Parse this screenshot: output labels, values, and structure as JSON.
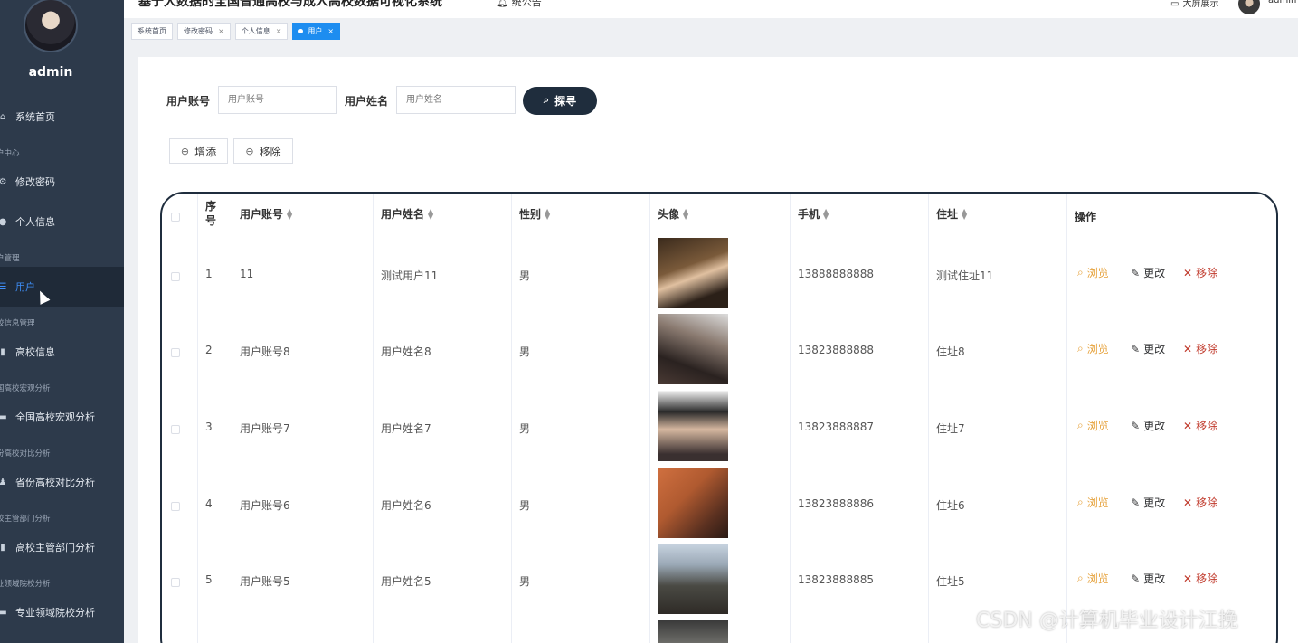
{
  "header": {
    "title": "基于大数据的全国普通高校与成人高校数据可视化系统",
    "notice": "统公告",
    "bigscreen": "大屏展示",
    "user": "admin"
  },
  "sidebar": {
    "username": "admin",
    "items": [
      {
        "label": "系统首页",
        "icon": "home-icon"
      },
      {
        "group": "户中心"
      },
      {
        "label": "修改密码",
        "icon": "lock-icon"
      },
      {
        "label": "个人信息",
        "icon": "person-icon"
      },
      {
        "group": "户管理"
      },
      {
        "label": "用户",
        "icon": "list-icon",
        "active": true
      },
      {
        "group": "校信息管理"
      },
      {
        "label": "高校信息",
        "icon": "chart-icon"
      },
      {
        "group": "国高校宏观分析"
      },
      {
        "label": "全国高校宏观分析",
        "icon": "dashboard-icon"
      },
      {
        "group": "份高校对比分析"
      },
      {
        "label": "省份高校对比分析",
        "icon": "user-icon"
      },
      {
        "group": "校主管部门分析"
      },
      {
        "label": "高校主管部门分析",
        "icon": "chart-icon"
      },
      {
        "group": "业领域院校分析"
      },
      {
        "label": "专业领域院校分析",
        "icon": "dashboard-icon"
      }
    ]
  },
  "tabs": [
    {
      "label": "系统首页",
      "closable": false
    },
    {
      "label": "修改密码",
      "closable": true
    },
    {
      "label": "个人信息",
      "closable": true
    },
    {
      "label": "用户",
      "closable": true,
      "active": true
    }
  ],
  "search": {
    "account_label": "用户账号",
    "account_placeholder": "用户账号",
    "name_label": "用户姓名",
    "name_placeholder": "用户姓名",
    "button": "探寻"
  },
  "actions": {
    "add": "增添",
    "remove": "移除"
  },
  "table": {
    "headers": [
      "序号",
      "用户账号",
      "用户姓名",
      "性别",
      "头像",
      "手机",
      "住址",
      "操作"
    ],
    "rows": [
      {
        "no": "1",
        "account": "11",
        "name": "测试用户11",
        "gender": "男",
        "phone": "13888888888",
        "address": "测试住址11"
      },
      {
        "no": "2",
        "account": "用户账号8",
        "name": "用户姓名8",
        "gender": "男",
        "phone": "13823888888",
        "address": "住址8"
      },
      {
        "no": "3",
        "account": "用户账号7",
        "name": "用户姓名7",
        "gender": "男",
        "phone": "13823888887",
        "address": "住址7"
      },
      {
        "no": "4",
        "account": "用户账号6",
        "name": "用户姓名6",
        "gender": "男",
        "phone": "13823888886",
        "address": "住址6"
      },
      {
        "no": "5",
        "account": "用户账号5",
        "name": "用户姓名5",
        "gender": "男",
        "phone": "13823888885",
        "address": "住址5"
      }
    ],
    "ops": {
      "view": "浏览",
      "edit": "更改",
      "delete": "移除"
    }
  },
  "watermark": "CSDN @计算机毕业设计江挽",
  "colors": {
    "sidebar_bg": "#2d3a4b",
    "accent": "#1d8df0",
    "view": "#e6a23c",
    "delete": "#c0392b",
    "search_btn": "#1f2d3d"
  }
}
